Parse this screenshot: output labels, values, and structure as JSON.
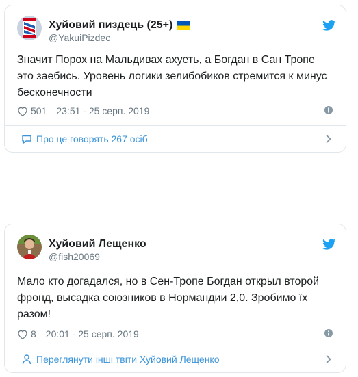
{
  "tweets": [
    {
      "display_name": "Хуйовий пиздець (25+)",
      "handle": "@YakuiPizdec",
      "text": "Значит Порох на Мальдивах ахуеть, а Богдан в Сан Тропе\nэто заебись. Уровень логики зелибобиков стремится к минус\nбесконечности",
      "likes": "501",
      "timestamp": "23:51 - 25 серп. 2019",
      "footer_label": "Про це говорять 267 осіб"
    },
    {
      "display_name": "Хуйовий Лещенко",
      "handle": "@fish20069",
      "text": "Мало кто догадался, но в Сен-Тропе Богдан открыл второй\nфронд, высадка союзников в Нормандии 2,0. Зробимо їх\nразом!",
      "likes": "8",
      "timestamp": "20:01 - 25 серп. 2019",
      "footer_label": "Переглянути інші твіти Хуйовий Лещенко"
    }
  ],
  "colors": {
    "accent": "#1da1f2",
    "link": "#3b94d9",
    "muted": "#697882",
    "border": "#e1e8ed",
    "flag_blue": "#0057b7",
    "flag_yellow": "#ffd700"
  },
  "icons": {
    "brand": "twitter-bird-icon",
    "like": "heart-icon",
    "info": "info-icon",
    "footer1": "speech-bubble-icon",
    "footer2": "person-icon",
    "chevron": "chevron-right-icon"
  }
}
